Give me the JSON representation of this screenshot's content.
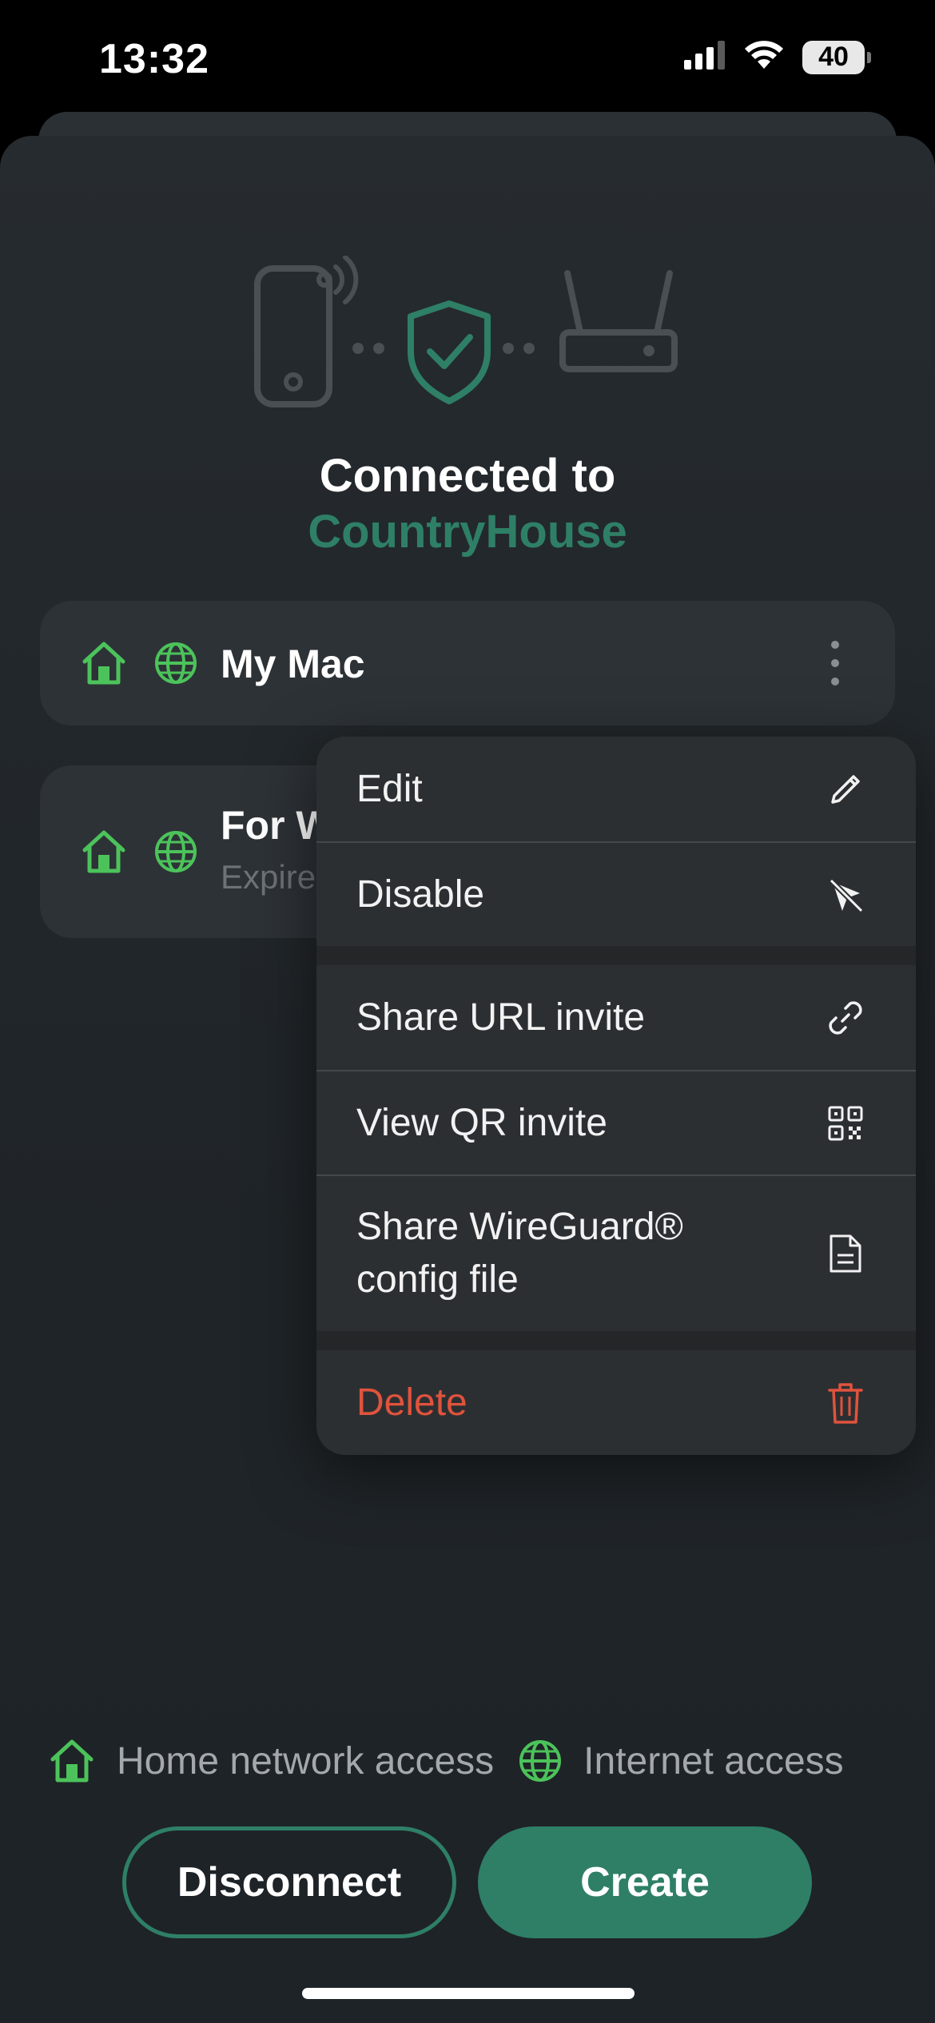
{
  "status_bar": {
    "time": "13:32",
    "battery": "40",
    "icons": [
      "signal-icon",
      "wifi-icon",
      "battery-icon"
    ]
  },
  "header": {
    "connected_label": "Connected to",
    "network_name": "CountryHouse"
  },
  "devices": [
    {
      "name": "My Mac",
      "subtitle": "",
      "icons": [
        "home-icon",
        "globe-icon"
      ]
    },
    {
      "name": "For W",
      "subtitle": "Expire",
      "icons": [
        "home-icon",
        "globe-icon"
      ]
    }
  ],
  "menu": {
    "items": [
      {
        "label": "Edit",
        "icon": "pencil-icon"
      },
      {
        "label": "Disable",
        "icon": "disable-icon"
      },
      {
        "label": "Share URL invite",
        "icon": "link-icon"
      },
      {
        "label": "View QR invite",
        "icon": "qr-icon"
      },
      {
        "label": "Share WireGuard® config file",
        "icon": "document-icon"
      },
      {
        "label": "Delete",
        "icon": "trash-icon"
      }
    ]
  },
  "legend": {
    "home": "Home network access",
    "internet": "Internet access"
  },
  "buttons": {
    "disconnect": "Disconnect",
    "create": "Create"
  },
  "colors": {
    "accent": "#2e7f66",
    "icon_green": "#4cc35a",
    "danger": "#e0533c",
    "background": "#22272b"
  }
}
